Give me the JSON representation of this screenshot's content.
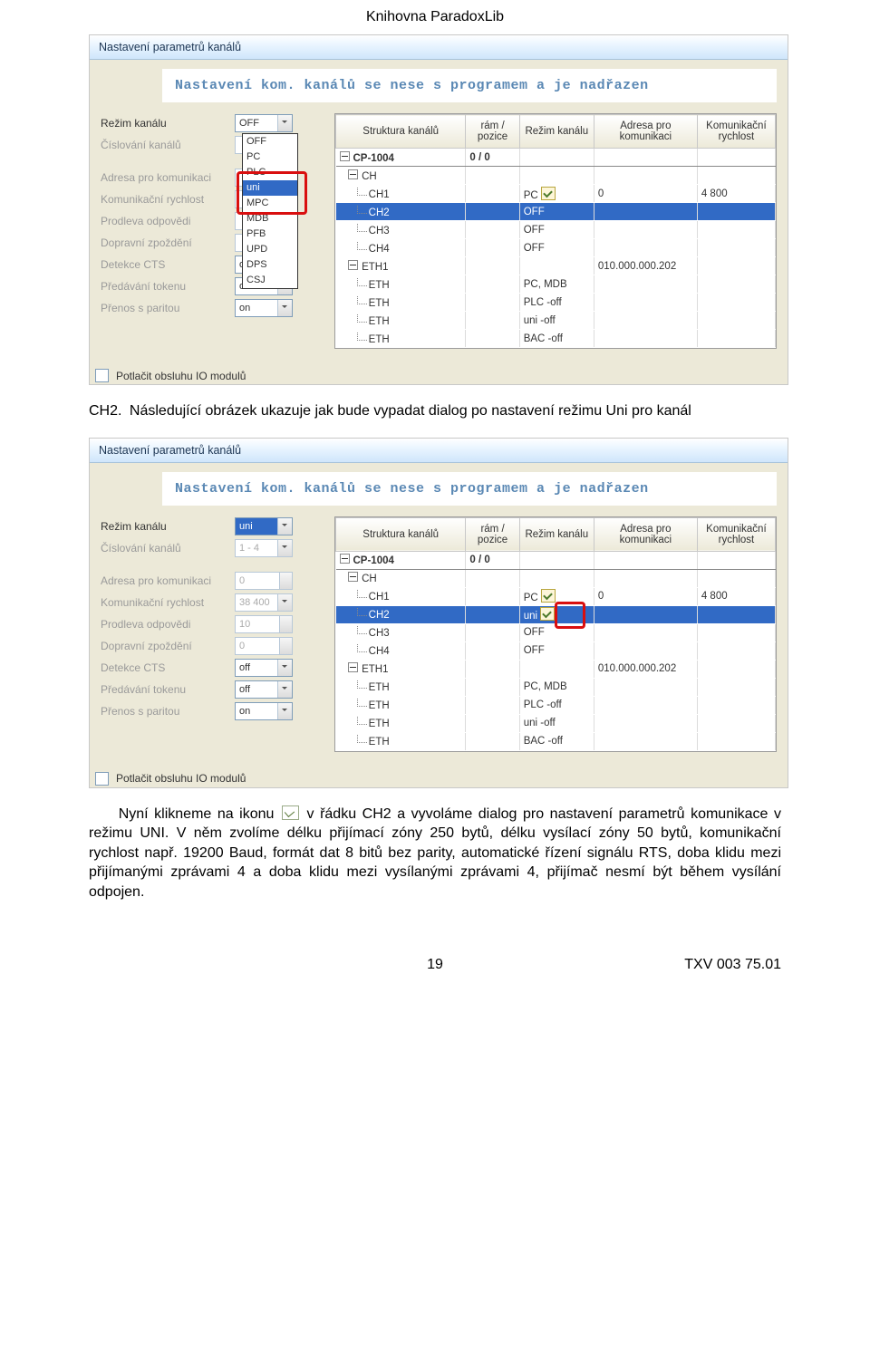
{
  "doc": {
    "header": "Knihovna ParadoxLib",
    "para1_prefix": "CH2.",
    "para1": "Následující obrázek ukazuje jak bude vypadat dialog po nastavení režimu Uni pro kanál",
    "para2a": "Nyní klikneme na ikonu",
    "para2b": "v řádku CH2 a vyvoláme dialog pro nastavení parametrů komunikace v režimu UNI. V něm zvolíme délku přijímací zóny 250 bytů, délku vysílací zóny 50 bytů, komunikační rychlost např. 19200 Baud, formát dat 8 bitů bez parity, automatické řízení signálu RTS, doba klidu mezi přijímanými zprávami 4 a doba klidu mezi vysílanými zprávami 4, přijímač nesmí být během vysílání odpojen.",
    "page_number": "19",
    "doc_id": "TXV 003 75.01"
  },
  "shot_common": {
    "titlebar": "Nastavení parametrů kanálů",
    "banner": "Nastavení kom. kanálů se nese s programem a je nadřazen",
    "suppress_io": "Potlačit obsluhu IO modulů",
    "headers": [
      "Struktura kanálů",
      "rám / pozice",
      "Režim kanálu",
      "Adresa pro komunikaci",
      "Komunikační rychlost"
    ],
    "param_labels": {
      "mode": "Režim kanálu",
      "numbering": "Číslování kanálů",
      "addr": "Adresa pro komunikaci",
      "speed": "Komunikační rychlost",
      "delay": "Prodleva odpovědi",
      "transport": "Dopravní zpoždění",
      "cts": "Detekce CTS",
      "token": "Předávání tokenu",
      "parity": "Přenos s paritou"
    }
  },
  "shot1": {
    "param_values": {
      "mode": "OFF",
      "cts": "off",
      "token": "off",
      "parity": "on"
    },
    "dropdown_options": [
      "OFF",
      "PC",
      "PLC",
      "uni",
      "MPC",
      "MDB",
      "PFB",
      "UPD",
      "DPS",
      "CSJ"
    ],
    "dropdown_selected": "uni",
    "rows": [
      {
        "c1": "CP-1004",
        "c2": "0 / 0",
        "c3": "",
        "c4": "",
        "c5": "",
        "bold": true,
        "toggle": true,
        "indent": 0
      },
      {
        "c1": "CH",
        "c2": "",
        "c3": "",
        "c4": "",
        "c5": "",
        "toggle": true,
        "indent": 1
      },
      {
        "c1": "CH1",
        "c2": "",
        "c3": "PC",
        "c4": "0",
        "c5": "4 800",
        "indent": 2,
        "chk": true
      },
      {
        "c1": "CH2",
        "c2": "",
        "c3": "OFF",
        "c4": "",
        "c5": "",
        "indent": 2,
        "sel": true
      },
      {
        "c1": "CH3",
        "c2": "",
        "c3": "OFF",
        "c4": "",
        "c5": "",
        "indent": 2
      },
      {
        "c1": "CH4",
        "c2": "",
        "c3": "OFF",
        "c4": "",
        "c5": "",
        "indent": 2
      },
      {
        "c1": "ETH1",
        "c2": "",
        "c3": "",
        "c4": "010.000.000.202",
        "c5": "",
        "toggle": true,
        "indent": 1
      },
      {
        "c1": "ETH",
        "c2": "",
        "c3": "PC, MDB",
        "c4": "",
        "c5": "",
        "indent": 2
      },
      {
        "c1": "ETH",
        "c2": "",
        "c3": "PLC -off",
        "c4": "",
        "c5": "",
        "indent": 2
      },
      {
        "c1": "ETH",
        "c2": "",
        "c3": "uni -off",
        "c4": "",
        "c5": "",
        "indent": 2
      },
      {
        "c1": "ETH",
        "c2": "",
        "c3": "BAC -off",
        "c4": "",
        "c5": "",
        "indent": 2
      }
    ]
  },
  "shot2": {
    "param_values": {
      "mode": "uni",
      "numbering": "1 - 4",
      "addr": "0",
      "speed": "38 400",
      "delay": "10",
      "transport": "0",
      "cts": "off",
      "token": "off",
      "parity": "on"
    },
    "rows": [
      {
        "c1": "CP-1004",
        "c2": "0 / 0",
        "c3": "",
        "c4": "",
        "c5": "",
        "bold": true,
        "toggle": true,
        "indent": 0
      },
      {
        "c1": "CH",
        "c2": "",
        "c3": "",
        "c4": "",
        "c5": "",
        "toggle": true,
        "indent": 1
      },
      {
        "c1": "CH1",
        "c2": "",
        "c3": "PC",
        "c4": "0",
        "c5": "4 800",
        "indent": 2,
        "chk": true
      },
      {
        "c1": "CH2",
        "c2": "",
        "c3": "uni",
        "c4": "",
        "c5": "",
        "indent": 2,
        "sel": true,
        "chk": true,
        "chk_red": true
      },
      {
        "c1": "CH3",
        "c2": "",
        "c3": "OFF",
        "c4": "",
        "c5": "",
        "indent": 2
      },
      {
        "c1": "CH4",
        "c2": "",
        "c3": "OFF",
        "c4": "",
        "c5": "",
        "indent": 2
      },
      {
        "c1": "ETH1",
        "c2": "",
        "c3": "",
        "c4": "010.000.000.202",
        "c5": "",
        "toggle": true,
        "indent": 1
      },
      {
        "c1": "ETH",
        "c2": "",
        "c3": "PC, MDB",
        "c4": "",
        "c5": "",
        "indent": 2
      },
      {
        "c1": "ETH",
        "c2": "",
        "c3": "PLC -off",
        "c4": "",
        "c5": "",
        "indent": 2
      },
      {
        "c1": "ETH",
        "c2": "",
        "c3": "uni -off",
        "c4": "",
        "c5": "",
        "indent": 2
      },
      {
        "c1": "ETH",
        "c2": "",
        "c3": "BAC -off",
        "c4": "",
        "c5": "",
        "indent": 2
      }
    ]
  }
}
